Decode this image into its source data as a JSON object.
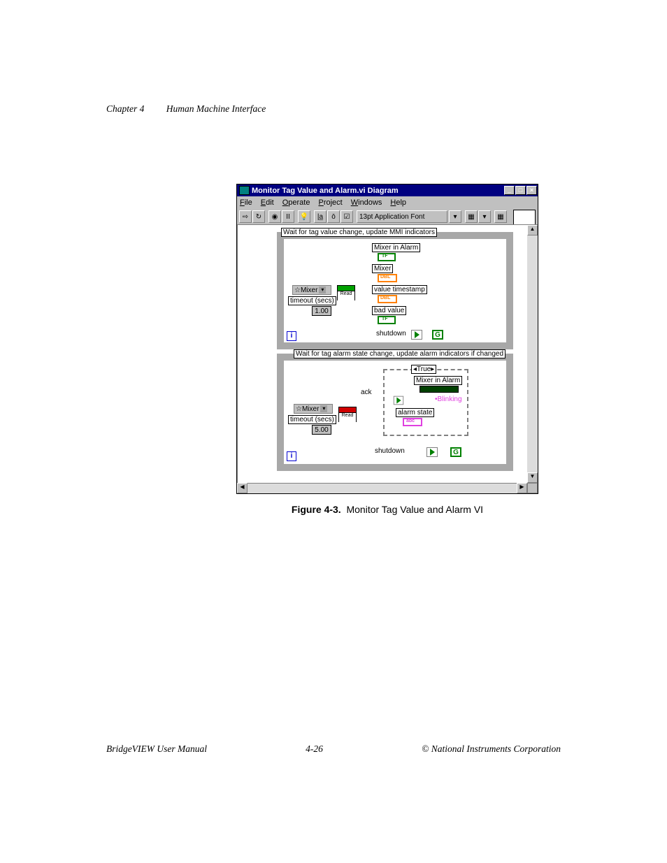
{
  "header": {
    "chapter": "Chapter 4",
    "title": "Human Machine Interface"
  },
  "window": {
    "title": "Monitor Tag Value and Alarm.vi Diagram",
    "btns": {
      "min": "_",
      "max": "□",
      "close": "×"
    },
    "menus": [
      "File",
      "Edit",
      "Operate",
      "Project",
      "Windows",
      "Help"
    ],
    "toolbar": {
      "run": "⇨",
      "cont": "↻",
      "stop": "◉",
      "pause": "II",
      "hilite": "💡",
      "probe": "|a̲",
      "break": "ō",
      "step": "☑",
      "font": "13pt Application Font",
      "align": "▾",
      "dist": "▾",
      "reorder": "▾"
    }
  },
  "frame1": {
    "label": "Wait for tag value change, update MMI indicators",
    "nodes": {
      "mixer_in_alarm": "Mixer in Alarm",
      "mixer": "Mixer",
      "value_timestamp": "value timestamp",
      "bad_value": "bad value",
      "shutdown": "shutdown",
      "mixer_ctrl": "Mixer",
      "timeout_lbl": "timeout (secs)",
      "timeout_val": "1.00",
      "vi_read": "Read"
    }
  },
  "frame2": {
    "label": "Wait for tag alarm state change, update alarm indicators if changed",
    "case": "True",
    "nodes": {
      "mixer_in_alarm": "Mixer in Alarm",
      "blinking": "Blinking",
      "alarm_state": "alarm state",
      "ack": "ack",
      "shutdown": "shutdown",
      "mixer_ctrl": "Mixer",
      "timeout_lbl": "timeout (secs)",
      "timeout_val": "5.00",
      "vi_read": "Read"
    }
  },
  "caption": {
    "bold": "Figure 4-3.",
    "text": "Monitor Tag Value and Alarm VI"
  },
  "footer": {
    "left": "BridgeVIEW User Manual",
    "center": "4-26",
    "right": "© National Instruments Corporation"
  }
}
